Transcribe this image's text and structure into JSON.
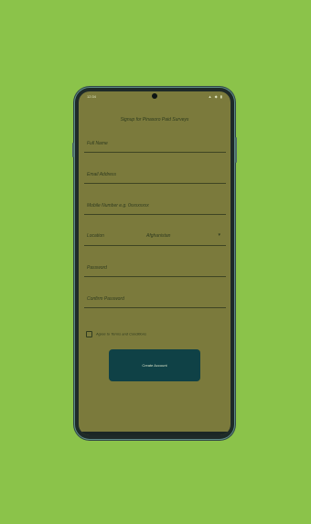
{
  "form": {
    "title": "Signup for Pinasoro Paid Surveys",
    "full_name_placeholder": "Full Name",
    "email_placeholder": "Email Address",
    "mobile_placeholder": "Mobile Number e.g. 0xxxxxxxx",
    "location_label": "Location",
    "location_value": "Afghanistan",
    "password_placeholder": "Password",
    "confirm_password_placeholder": "Confirm Password",
    "terms_label": "Agree to Terms and Conditions",
    "submit_label": "Create Account"
  },
  "statusbar": {
    "time": "12:34",
    "icons": "▲ ◆ ▮"
  },
  "colors": {
    "background": "#8bc34a",
    "screen": "#7b7a3c",
    "button": "#0f4146"
  }
}
